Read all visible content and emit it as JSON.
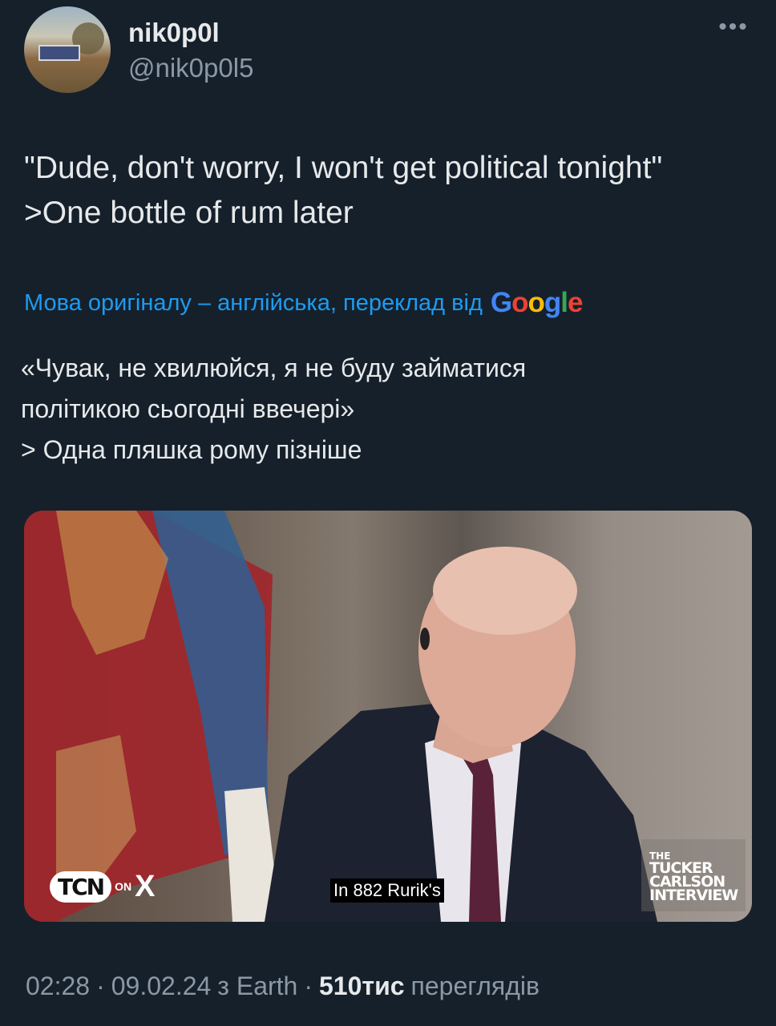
{
  "author": {
    "display_name": "nik0p0l",
    "handle": "@nik0p0l5",
    "more_label": "•••"
  },
  "tweet": {
    "lines": [
      "\"Dude, don't worry, I won't get political tonight\"",
      ">One bottle of rum later"
    ]
  },
  "translation": {
    "label": "Мова оригіналу – англійська, переклад від",
    "provider": "Google",
    "lines": [
      "«Чувак, не хвилюйся, я не буду займатися",
      "політикою сьогодні ввечері»",
      "> Одна пляшка рому пізніше"
    ]
  },
  "media": {
    "tcn_logo": "TCN",
    "tcn_on": "ON",
    "tcn_x": "X",
    "caption": "In 882 Rurik's",
    "interview_logo": [
      "THE",
      "TUCKER",
      "CARLSON",
      "INTERVIEW"
    ]
  },
  "meta": {
    "time": "02:28",
    "date": "09.02.24",
    "source": "з Earth",
    "views_count": "510тис",
    "views_label": "переглядів",
    "separator": "·"
  },
  "colors": {
    "background": "#15202b",
    "accent": "#1d9bf0",
    "secondary_text": "#8b98a5"
  }
}
